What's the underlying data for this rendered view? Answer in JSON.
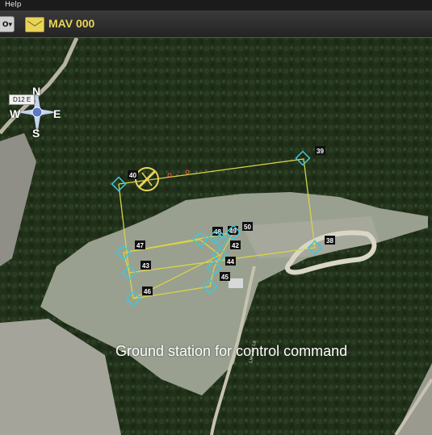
{
  "menu": {
    "help_label": "Help"
  },
  "toolbar": {
    "dropdown_label": "O",
    "vehicle_name": "MAV 000",
    "vehicle_icon": "envelope-icon"
  },
  "compass": {
    "north": "N",
    "south": "S",
    "east": "E",
    "west": "W",
    "heading_label": "D12 E"
  },
  "waypoints": [
    {
      "id": "39",
      "label": "39"
    },
    {
      "id": "40",
      "label": "40"
    },
    {
      "id": "38",
      "label": "38"
    },
    {
      "id": "47",
      "label": "47"
    },
    {
      "id": "43",
      "label": "43"
    },
    {
      "id": "46",
      "label": "46"
    },
    {
      "id": "48",
      "label": "48"
    },
    {
      "id": "49",
      "label": "49"
    },
    {
      "id": "50",
      "label": "50"
    },
    {
      "id": "42",
      "label": "42"
    },
    {
      "id": "44",
      "label": "44"
    },
    {
      "id": "45",
      "label": "45"
    }
  ],
  "caption": "Ground station for control command",
  "road_label": "Lieu-dit La",
  "colors": {
    "route": "#d8d24a",
    "waypoint": "#3fc7d8",
    "label_bg": "#111111",
    "vehicle": "#e9d45a"
  }
}
